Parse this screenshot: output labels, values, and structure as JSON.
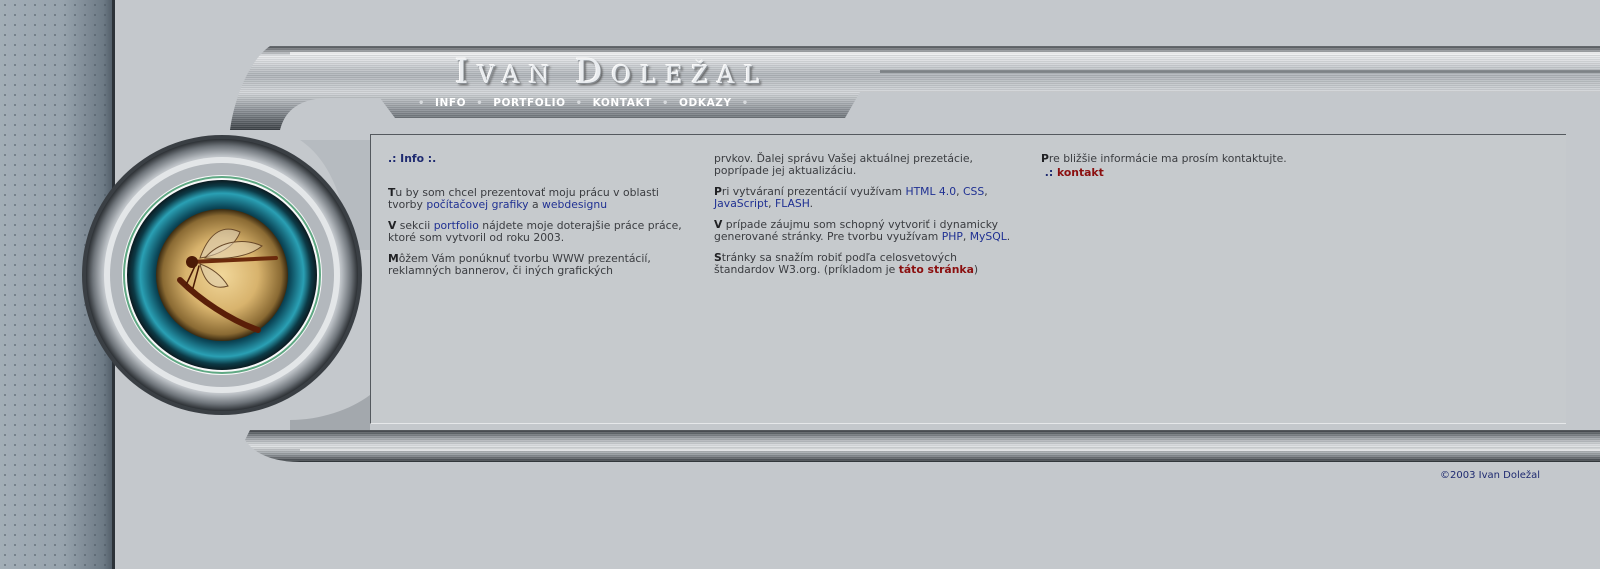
{
  "site": {
    "title_first": "I",
    "title_rest1": "VAN ",
    "title_cap2": "D",
    "title_rest2": "OLEŽAL"
  },
  "nav": {
    "items": [
      "INFO",
      "PORTFOLIO",
      "KONTAKT",
      "ODKAZY"
    ]
  },
  "col1": {
    "heading": ".: Info :.",
    "p1_lead": "T",
    "p1_text1": "u by som chcel prezentovať moju prácu v oblasti tvorby ",
    "p1_link1": "počítačovej grafiky",
    "p1_text2": " a ",
    "p1_link2": "webdesignu",
    "p2_lead": "V",
    "p2_text1": " sekcii ",
    "p2_link": "portfolio",
    "p2_text2": " nájdete moje doterajšie práce práce, ktoré som vytvoril od roku 2003.",
    "p3_lead": "M",
    "p3_text": "ôžem Vám ponúknuť tvorbu WWW prezentácií, reklamných bannerov, či iných grafických"
  },
  "col2": {
    "p0_text": "prvkov. Ďalej správu Vašej aktuálnej prezetácie, poprípade jej aktualizáciu.",
    "p1_lead": "P",
    "p1_text1": "ri vytváraní prezentácií využívam ",
    "p1_link1": "HTML 4.0",
    "p1_sep1": ", ",
    "p1_link2": "CSS",
    "p1_sep2": ", ",
    "p1_link3": "JavaScript",
    "p1_sep3": ", ",
    "p1_link4": "FLASH",
    "p1_end": ".",
    "p2_lead": "V",
    "p2_text1": " prípade záujmu som schopný vytvoriť i dynamicky generované stránky. Pre tvorbu využívam ",
    "p2_link1": "PHP",
    "p2_sep": ", ",
    "p2_link2": "MySQL",
    "p2_end": ".",
    "p3_lead": "S",
    "p3_text1": "tránky sa snažím robiť podľa celosvetových štandardov W3.org. (príkladom je ",
    "p3_link": "táto stránka",
    "p3_end": ")"
  },
  "col3": {
    "p1_lead": "P",
    "p1_text": "re bližšie informácie ma prosím kontaktujte.",
    "contact_prefix": ".: ",
    "contact_link": "kontakt"
  },
  "footer": {
    "copyright": "©2003 Ivan Doležal"
  },
  "icons": {
    "emblem": "dragonfly-emblem-icon"
  },
  "colors": {
    "background": "#c4c8cc",
    "link": "#1f3092",
    "link_highlight": "#8b0f0f",
    "heading": "#1e2a70"
  }
}
